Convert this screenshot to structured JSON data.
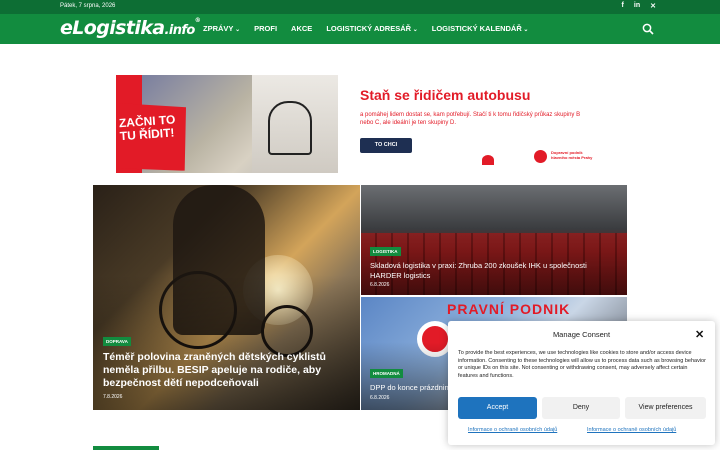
{
  "topbar": {
    "date": "Pátek, 7 srpna, 2026",
    "social": [
      "f",
      "in",
      "✕"
    ]
  },
  "header": {
    "logo_main": "eLogistika",
    "logo_suffix": ".info",
    "logo_reg": "®",
    "nav": [
      {
        "label": "ZPRÁVY",
        "dropdown": true
      },
      {
        "label": "PROFI",
        "dropdown": false
      },
      {
        "label": "AKCE",
        "dropdown": false
      },
      {
        "label": "LOGISTICKÝ ADRESÁŘ",
        "dropdown": true
      },
      {
        "label": "LOGISTICKÝ KALENDÁŘ",
        "dropdown": true
      }
    ],
    "search_icon": "search-icon"
  },
  "banner": {
    "badge": "ZAČNI TO TU ŘÍDIT!",
    "headline": "Staň se řidičem autobusu",
    "text": "a pomáhej lidem dostat se, kam potřebují. Stačí ti k tomu řidičský průkaz skupiny B nebo C, ale ideální je ten skupiny D.",
    "cta": "TO CHCI",
    "sponsor": "Dopravní podnik hlavního města Prahy",
    "brand_color": "#e21b27"
  },
  "articles": {
    "big": {
      "tag": "DOPRAVA",
      "title": "Téměř polovina zraněných dětských cyklistů neměla přilbu. BESIP apeluje na rodiče, aby bezpečnost dětí nepodceňovali",
      "date": "7.8.2026"
    },
    "top": {
      "tag": "LOGISTIKA",
      "title": "Skladová logistika v praxi: Zhruba 200 zkoušek IHK u společnosti HARDER logistics",
      "date": "6.8.2026"
    },
    "bottom": {
      "tag": "HROMADNÁ",
      "title": "DPP do konce prázdnin",
      "date": "6.8.2026",
      "sign": "PRAVNÍ PODNIK"
    }
  },
  "consent": {
    "title": "Manage Consent",
    "body": "To provide the best experiences, we use technologies like cookies to store and/or access device information. Consenting to these technologies will allow us to process data such as browsing behavior or unique IDs on this site. Not consenting or withdrawing consent, may adversely affect certain features and functions.",
    "accept": "Accept",
    "deny": "Deny",
    "preferences": "View preferences",
    "link1": "Informace o ochraně osobních údajů",
    "link2": "Informace o ochraně osobních údajů",
    "accent_color": "#1e73be"
  }
}
